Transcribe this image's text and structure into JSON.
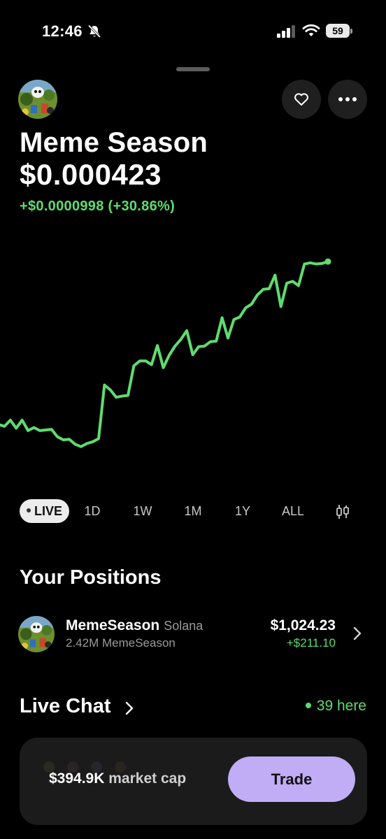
{
  "status_bar": {
    "time": "12:46",
    "battery": "59",
    "icons": [
      "bell-slash-icon",
      "cellular-signal-icon",
      "wifi-icon",
      "battery-icon"
    ]
  },
  "token": {
    "name": "Meme Season",
    "price": "$0.000423",
    "change": "+$0.0000998 (+30.86%)",
    "logo": "meme-season-logo"
  },
  "header_actions": [
    "heart-icon",
    "more-icon"
  ],
  "colors": {
    "accent_green": "#5fdc6e",
    "trade_button": "#c1acf6",
    "background": "#000000",
    "card": "#1b1b1b"
  },
  "chart_data": {
    "type": "line",
    "series": [
      {
        "values": [
          26.0,
          25.7,
          26.7,
          25.4,
          26.7,
          25.0,
          25.5,
          25.0,
          25.1,
          25.2,
          24.0,
          23.5,
          23.6,
          22.8,
          22.4,
          22.9,
          23.2,
          23.7,
          32.4,
          31.6,
          30.4,
          30.6,
          30.7,
          35.5,
          36.3,
          36.3,
          35.7,
          38.8,
          35.2,
          37.2,
          38.7,
          39.8,
          41.2,
          37.3,
          38.6,
          38.7,
          39.4,
          39.5,
          43.3,
          40.0,
          43.0,
          43.4,
          44.9,
          45.5,
          47.0,
          47.9,
          48.0,
          50.2,
          45.1,
          48.9,
          49.2,
          48.5,
          52.0,
          52.2,
          52.0,
          52.1,
          52.4
        ]
      }
    ],
    "unit": "price index (axis not shown)"
  },
  "ranges": {
    "items": [
      "LIVE",
      "1D",
      "1W",
      "1M",
      "1Y",
      "ALL"
    ],
    "active": "LIVE"
  },
  "positions": {
    "title": "Your Positions",
    "items": [
      {
        "name": "MemeSeason",
        "chain": "Solana",
        "quantity": "2.42M MemeSeason",
        "value": "$1,024.23",
        "gain": "+$211.10"
      }
    ]
  },
  "chat": {
    "title": "Live Chat",
    "online": "39 here"
  },
  "bottom": {
    "market_cap_value": "$394.9K",
    "market_cap_label": "market cap",
    "trade_label": "Trade"
  }
}
